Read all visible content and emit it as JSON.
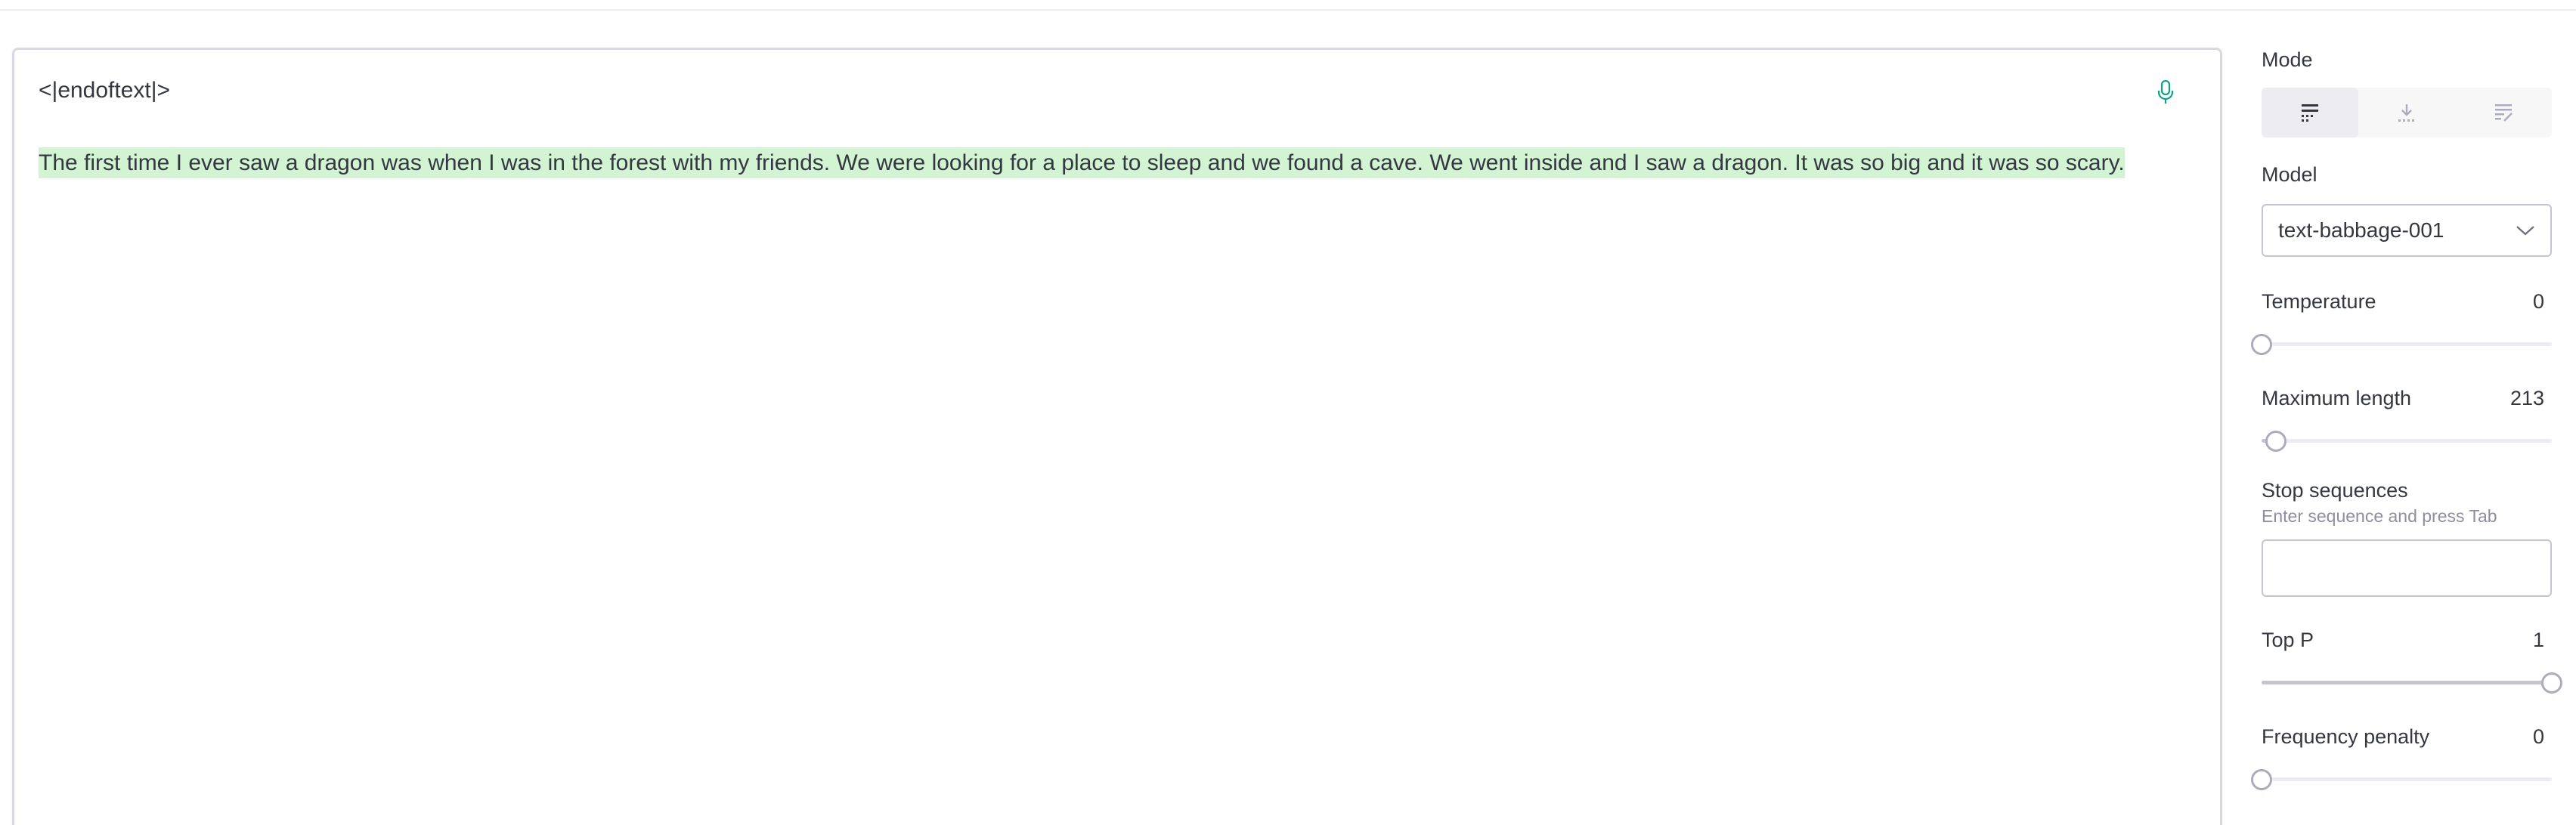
{
  "editor": {
    "eot_token": "<|endoftext|>",
    "completion": "The first time I ever saw a dragon was when I was in the forest with my friends. We were looking for a place to sleep and we found a cave. We went inside and I saw a dragon. It was so big and it was so scary.",
    "mic_icon": "microphone-icon",
    "highlight_color": "#d2f4d3",
    "mic_color": "#10a37f"
  },
  "sidebar": {
    "mode": {
      "label": "Mode",
      "options": [
        {
          "icon": "complete-mode-icon",
          "active": true
        },
        {
          "icon": "insert-mode-icon",
          "active": false
        },
        {
          "icon": "edit-mode-icon",
          "active": false
        }
      ]
    },
    "model": {
      "label": "Model",
      "value": "text-babbage-001"
    },
    "temperature": {
      "label": "Temperature",
      "value": "0",
      "fraction": 0
    },
    "max_length": {
      "label": "Maximum length",
      "value": "213",
      "fraction": 0.05
    },
    "stop_sequences": {
      "label": "Stop sequences",
      "hint": "Enter sequence and press Tab",
      "value": ""
    },
    "top_p": {
      "label": "Top P",
      "value": "1",
      "fraction": 1
    },
    "frequency_penalty": {
      "label": "Frequency penalty",
      "value": "0",
      "fraction": 0
    }
  }
}
